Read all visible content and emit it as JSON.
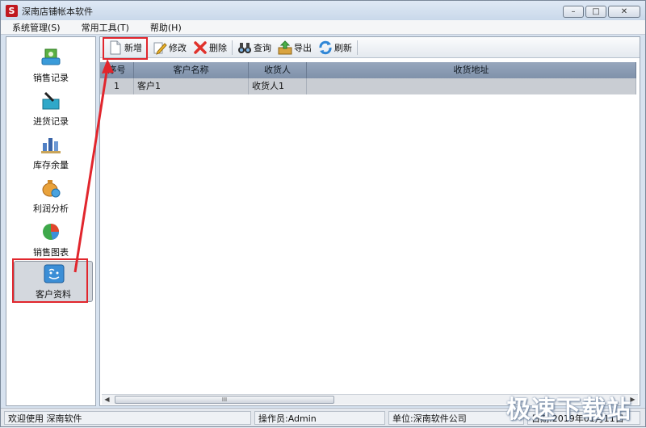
{
  "window": {
    "title": "深南店铺帐本软件",
    "app_icon_letter": "S",
    "buttons": [
      "minimize-icon",
      "maximize-icon",
      "close-icon"
    ]
  },
  "menu": {
    "items": [
      {
        "label": "系统管理(S)"
      },
      {
        "label": "常用工具(T)"
      },
      {
        "label": "帮助(H)"
      }
    ]
  },
  "sidebar": {
    "items": [
      {
        "label": "销售记录",
        "icon": "sales-record-icon"
      },
      {
        "label": "进货记录",
        "icon": "purchase-record-icon"
      },
      {
        "label": "库存余量",
        "icon": "inventory-icon"
      },
      {
        "label": "利润分析",
        "icon": "profit-analysis-icon"
      },
      {
        "label": "销售图表",
        "icon": "pie-chart-icon"
      },
      {
        "label": "客户资料",
        "icon": "customer-info-icon",
        "active": true
      }
    ]
  },
  "toolbar": {
    "new_label": "新增",
    "edit_label": "修改",
    "delete_label": "删除",
    "query_label": "查询",
    "export_label": "导出",
    "refresh_label": "刷新"
  },
  "table": {
    "columns": [
      "序号",
      "客户名称",
      "收货人",
      "收货地址"
    ],
    "rows": [
      {
        "index": "1",
        "name": "客户1",
        "receiver": "收货人1",
        "address": ""
      }
    ]
  },
  "scrollbar": {
    "thumb_grip": "III"
  },
  "status": {
    "welcome": "欢迎使用 深南软件",
    "operator": "操作员:Admin",
    "company": "单位:深南软件公司",
    "date": "日期:2019年01月11日"
  },
  "watermark": "极速下载站",
  "colors": {
    "highlight": "#e1262d",
    "grid_header": "#8a9bb3",
    "selected_row": "#c9cdd3"
  }
}
